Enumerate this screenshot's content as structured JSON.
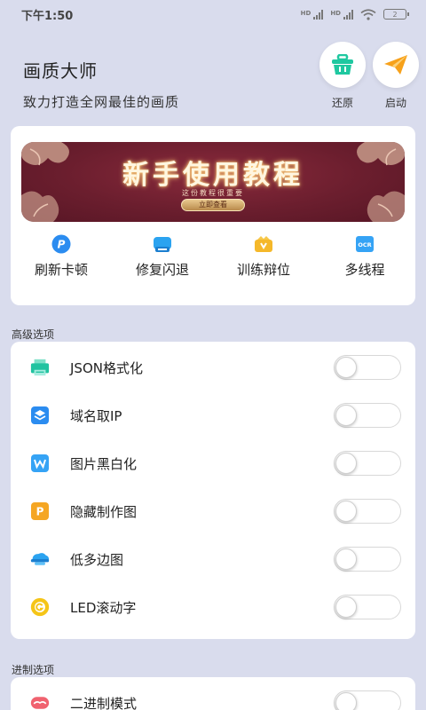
{
  "status": {
    "time": "下午1:50",
    "battery": "2"
  },
  "header": {
    "title": "画质大师",
    "subtitle": "致力打造全网最佳的画质"
  },
  "actions": [
    {
      "label": "还原",
      "icon": "basket-icon",
      "color": "#1fc8a0"
    },
    {
      "label": "启动",
      "icon": "paper-plane-icon",
      "color": "#f7a11a"
    }
  ],
  "banner": {
    "title": "新手使用教程",
    "subtitle": "这份教程很重要",
    "button": "立即查看"
  },
  "tools": [
    {
      "label": "刷新卡顿",
      "icon": "refresh-p-icon",
      "color": "#2b8cf0"
    },
    {
      "label": "修复闪退",
      "icon": "cloud-fix-icon",
      "color": "#2ba3f0"
    },
    {
      "label": "训练辩位",
      "icon": "wallet-icon",
      "color": "#f5b82a"
    },
    {
      "label": "多线程",
      "icon": "ocr-icon",
      "color": "#35a3f5"
    }
  ],
  "sections": {
    "advanced": "高级选项",
    "binary": "进制选项"
  },
  "advanced_options": [
    {
      "label": "JSON格式化",
      "icon": "printer-icon",
      "color": "#22c3a0",
      "enabled": false
    },
    {
      "label": "域名取IP",
      "icon": "layers-icon",
      "color": "#2b8cf0",
      "enabled": false
    },
    {
      "label": "图片黑白化",
      "icon": "w-doc-icon",
      "color": "#35a3f5",
      "enabled": false
    },
    {
      "label": "隐藏制作图",
      "icon": "p-doc-icon",
      "color": "#f5a623",
      "enabled": false
    },
    {
      "label": "低多边图",
      "icon": "cloud-icon",
      "color": "#2ba3f0",
      "enabled": false
    },
    {
      "label": "LED滚动字",
      "icon": "g-coin-icon",
      "color": "#f5c518",
      "enabled": false
    }
  ],
  "binary_options": [
    {
      "label": "二进制模式",
      "icon": "mustache-icon",
      "color": "#f0626f",
      "enabled": false
    }
  ]
}
